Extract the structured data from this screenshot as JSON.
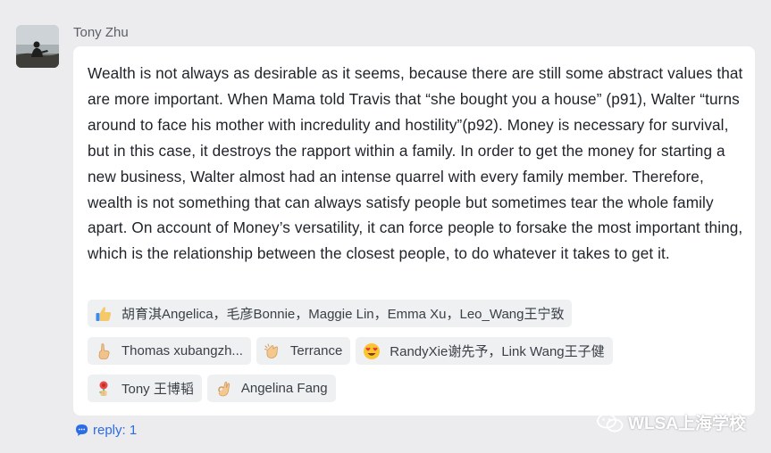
{
  "post": {
    "username": "Tony Zhu",
    "message": "Wealth is not always as desirable as it seems, because there are still some abstract values that are more important. When Mama told Travis that “she bought you a house” (p91), Walter “turns around to face his mother with incredulity and hostility”(p92). Money is necessary for survival, but in this case, it destroys the rapport within a family. In order to get the money for starting a new business, Walter almost had an intense quarrel with every family member. Therefore, wealth is not something that can always satisfy people but sometimes tear the whole family apart. On account of Money’s versatility, it can force people to forsake the most important thing, which is the relationship between the closest people, to do whatever it takes to get it."
  },
  "reactions": [
    {
      "icon": "thumbs-up-icon",
      "users": "胡育淇Angelica，毛彦Bonnie，Maggie Lin，Emma Xu，Leo_Wang王宁致"
    },
    {
      "icon": "pointing-hand-icon",
      "users": "Thomas xubangzh..."
    },
    {
      "icon": "clapping-hands-icon",
      "users": "Terrance"
    },
    {
      "icon": "heart-eyes-icon",
      "users": "RandyXie谢先予，Link Wang王子健"
    },
    {
      "icon": "flower-icon",
      "users": "Tony 王博韬"
    },
    {
      "icon": "ok-hand-icon",
      "users": "Angelina Fang"
    }
  ],
  "reply": {
    "label": "reply: 1"
  },
  "watermark": {
    "text": "WLSA上海学校"
  },
  "colors": {
    "link": "#2b6de3",
    "card": "#ffffff",
    "background": "#ececee"
  }
}
